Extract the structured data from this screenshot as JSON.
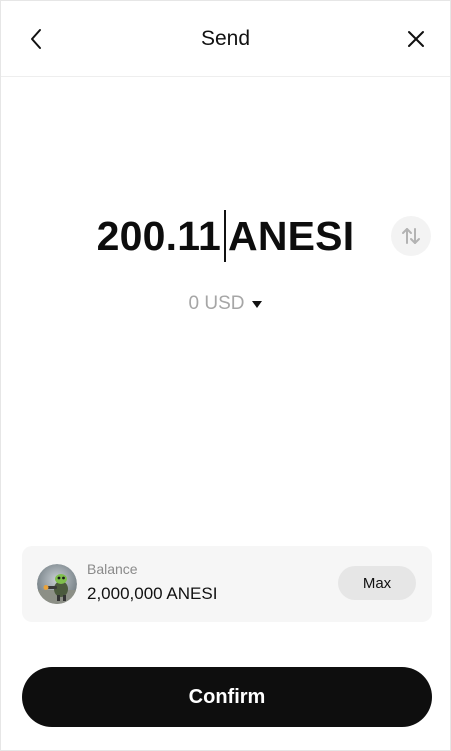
{
  "header": {
    "title": "Send",
    "back_icon": "chevron-left-icon",
    "close_icon": "close-icon"
  },
  "amount": {
    "value": "200.11",
    "token": "ANESI",
    "swap_icon": "swap-vertical-arrows-icon"
  },
  "fiat": {
    "text": "0 USD",
    "dropdown_icon": "caret-down-icon"
  },
  "balance": {
    "label": "Balance",
    "value": "2,000,000 ANESI",
    "max_label": "Max",
    "avatar_icon": "token-avatar-icon"
  },
  "confirm": {
    "label": "Confirm"
  },
  "colors": {
    "primary_button": "#0e0e0e",
    "muted_text": "#a6a6a6",
    "card_bg": "#f6f6f6"
  }
}
